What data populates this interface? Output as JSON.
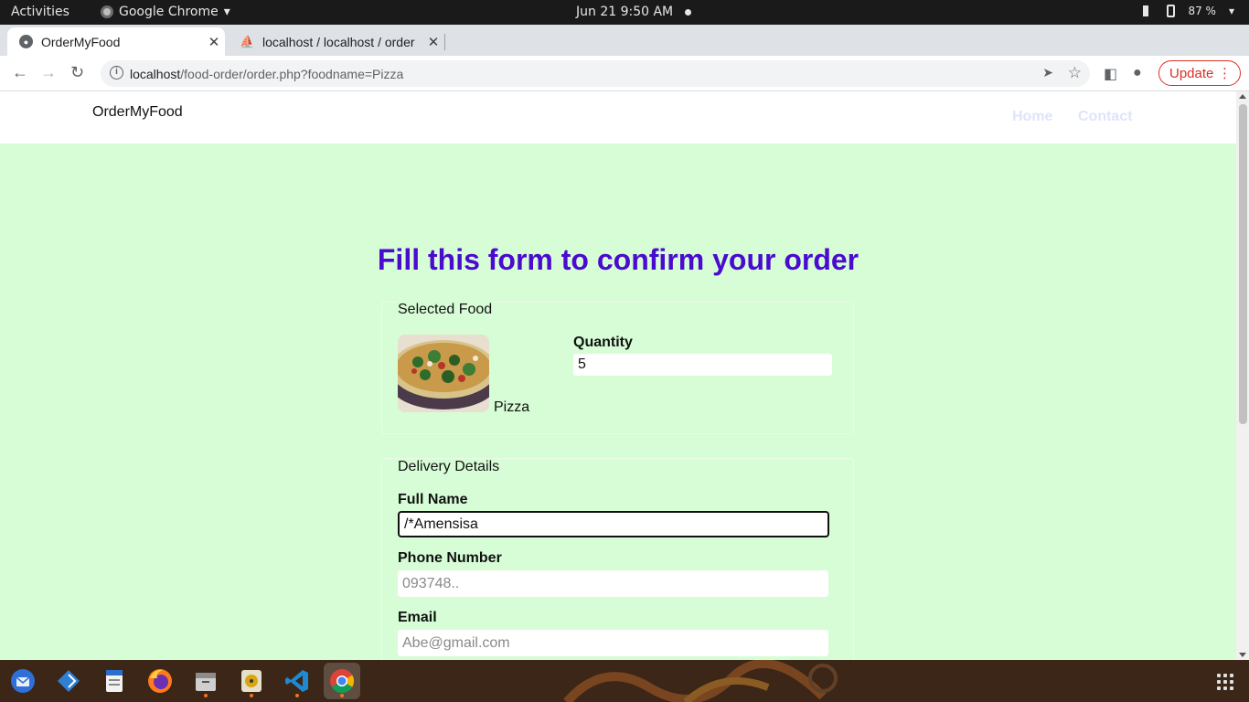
{
  "system_bar": {
    "activities": "Activities",
    "app_name": "Google Chrome",
    "clock": "Jun 21   9:50 AM",
    "battery": "87 %"
  },
  "tabs": [
    {
      "title": "OrderMyFood",
      "active": true
    },
    {
      "title": "localhost / localhost / order",
      "active": false
    }
  ],
  "toolbar": {
    "url_host": "localhost",
    "url_path": "/food-order/order.php?foodname=Pizza",
    "update_label": "Update"
  },
  "site": {
    "brand": "OrderMyFood",
    "nav": [
      "Home",
      "Contact"
    ]
  },
  "page": {
    "heading": "Fill this form to confirm your order",
    "selected_food": {
      "legend": "Selected Food",
      "food_name": "Pizza",
      "quantity_label": "Quantity",
      "quantity_value": "5"
    },
    "delivery": {
      "legend": "Delivery Details",
      "full_name_label": "Full Name",
      "full_name_value": "/*Amensisa",
      "phone_label": "Phone Number",
      "phone_placeholder": "093748..",
      "email_label": "Email",
      "email_placeholder": "Abe@gmail.com"
    }
  },
  "dock": {
    "apps": [
      "thunderbird-icon",
      "remmina-icon",
      "text-editor-icon",
      "firefox-icon",
      "files-icon",
      "rhythmbox-icon",
      "vscode-icon",
      "chrome-icon"
    ]
  },
  "colors": {
    "page_bg": "#d6fdd6",
    "heading": "#4b0ad0",
    "nav_link": "#e0e4fb",
    "update_red": "#d93025"
  }
}
